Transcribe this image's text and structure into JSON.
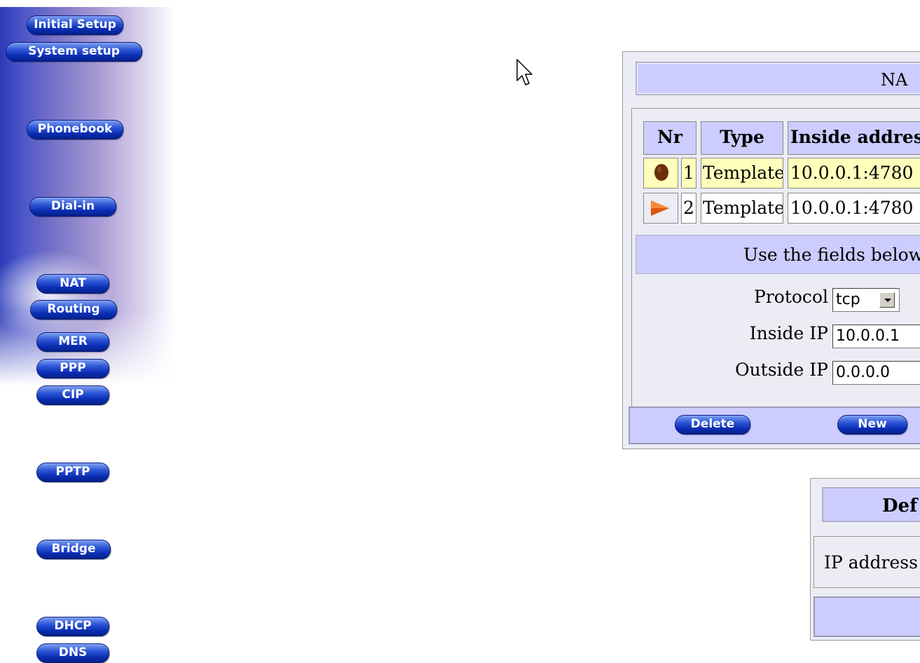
{
  "nav": {
    "items": [
      {
        "label": "Initial Setup"
      },
      {
        "label": "System setup"
      },
      {
        "label": "Phonebook"
      },
      {
        "label": "Dial-in"
      },
      {
        "label": "NAT"
      },
      {
        "label": "Routing"
      },
      {
        "label": "MER"
      },
      {
        "label": "PPP"
      },
      {
        "label": "CIP"
      },
      {
        "label": "PPTP"
      },
      {
        "label": "Bridge"
      },
      {
        "label": "DHCP"
      },
      {
        "label": "DNS"
      }
    ]
  },
  "nat_panel": {
    "title": "NA",
    "columns": [
      "Nr",
      "Type",
      "Inside addres"
    ],
    "rows": [
      {
        "nr": "1",
        "type": "Template",
        "inside": "10.0.0.1:4780",
        "icon": "circle-icon",
        "selected": true
      },
      {
        "nr": "2",
        "type": "Template",
        "inside": "10.0.0.1:4780",
        "icon": "arrow-right-icon",
        "selected": false
      }
    ],
    "info": "Use the fields below",
    "form": {
      "protocol_label": "Protocol",
      "protocol_value": "tcp",
      "inside_ip_label": "Inside IP",
      "inside_ip_value": "10.0.0.1",
      "outside_ip_label": "Outside IP",
      "outside_ip_value": "0.0.0.0"
    },
    "buttons": {
      "delete": "Delete",
      "new": "New"
    }
  },
  "default_panel": {
    "title": "Def",
    "ip_label": "IP address"
  },
  "colors": {
    "panel_header": "#ccccff",
    "selected_row": "#ffffbb",
    "button_blue": "#0b2fb6",
    "icon_brown": "#6b2e0c",
    "icon_orange": "#e0560e"
  }
}
